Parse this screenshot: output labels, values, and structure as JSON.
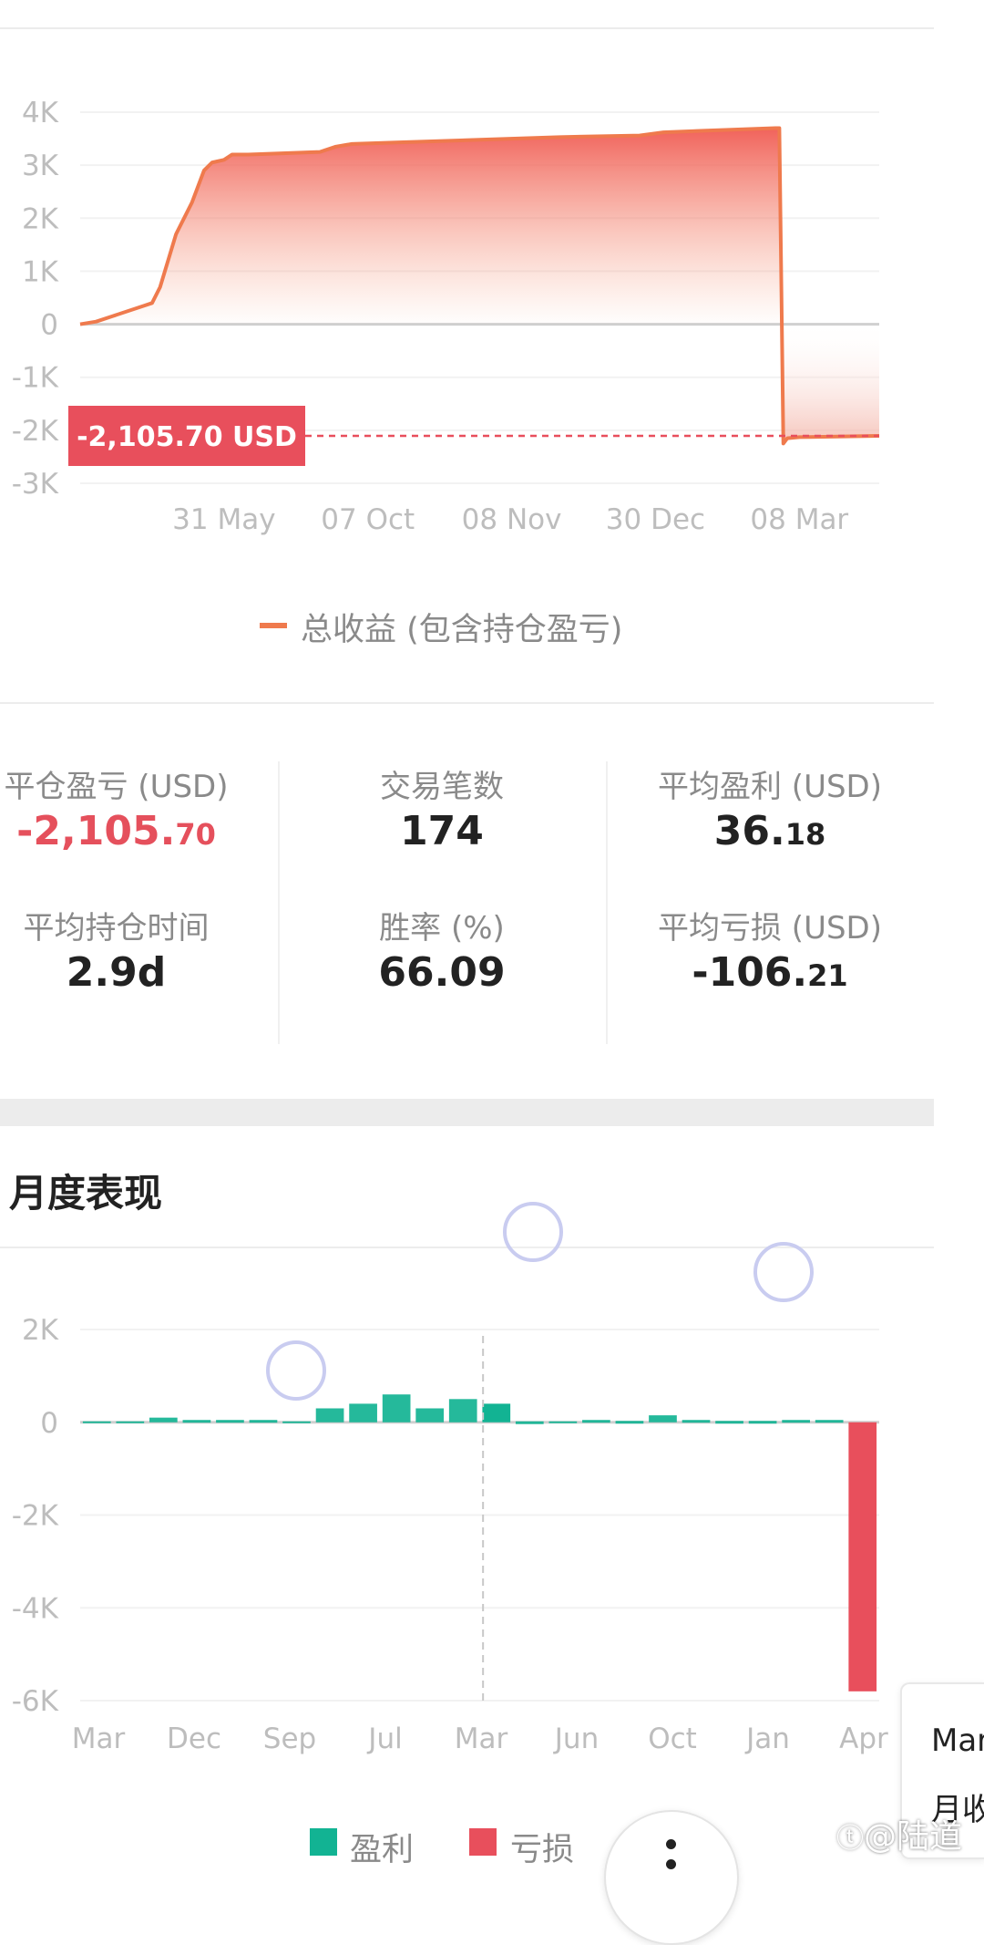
{
  "line_chart_data": {
    "type": "area",
    "series": [
      {
        "name": "总收益 (包含持仓盈亏)"
      }
    ],
    "y_ticks": [
      "4K",
      "3K",
      "2K",
      "1K",
      "0",
      "-1K",
      "-2K",
      "-3K"
    ],
    "y_tick_values": [
      4000,
      3000,
      2000,
      1000,
      0,
      -1000,
      -2000,
      -3000
    ],
    "ylim": [
      -3000,
      4000
    ],
    "x_ticks": [
      "31 May",
      "07 Oct",
      "08 Nov",
      "30 Dec",
      "08 Mar"
    ],
    "x_tick_index": [
      0.18,
      0.36,
      0.54,
      0.72,
      0.9
    ],
    "points_x": [
      0,
      0.02,
      0.04,
      0.08,
      0.09,
      0.1,
      0.12,
      0.14,
      0.155,
      0.165,
      0.18,
      0.19,
      0.21,
      0.3,
      0.32,
      0.34,
      0.4,
      0.5,
      0.6,
      0.7,
      0.73,
      0.78,
      0.87,
      0.875,
      0.88,
      0.885,
      0.9,
      1.0
    ],
    "points_y": [
      0,
      50,
      150,
      350,
      400,
      700,
      1700,
      2300,
      2900,
      3050,
      3100,
      3200,
      3200,
      3250,
      3350,
      3400,
      3430,
      3480,
      3530,
      3560,
      3620,
      3650,
      3700,
      3700,
      -2250,
      -2150,
      -2130,
      -2105.7
    ],
    "current_value_label": "-2,105.70 USD",
    "current_value": -2105.7,
    "line_color": "#ef7a4d",
    "marker_color": "#e84f5c"
  },
  "stats": {
    "closed_pnl": {
      "label": "平仓盈亏 (USD)",
      "int": "-2,105.",
      "dec": "70"
    },
    "trade_count": {
      "label": "交易笔数",
      "int": "174",
      "dec": ""
    },
    "avg_profit": {
      "label": "平均盈利 (USD)",
      "int": "36.",
      "dec": "18"
    },
    "avg_hold": {
      "label": "平均持仓时间",
      "int": "2.9d",
      "dec": ""
    },
    "win_rate": {
      "label": "胜率 (%)",
      "int": "66.09",
      "dec": ""
    },
    "avg_loss": {
      "label": "平均亏损 (USD)",
      "int": "-106.",
      "dec": "21"
    }
  },
  "monthly": {
    "title": "月度表现"
  },
  "chart_data": {
    "type": "bar",
    "y_ticks": [
      "2K",
      "0",
      "-2K",
      "-4K",
      "-6K"
    ],
    "y_tick_values": [
      2000,
      0,
      -2000,
      -4000,
      -6000
    ],
    "ylim": [
      -6000,
      2000
    ],
    "x_ticks": [
      "Mar",
      "Dec",
      "Sep",
      "Jul",
      "Mar",
      "Jun",
      "Oct",
      "Jan",
      "Apr"
    ],
    "values": [
      0,
      0,
      100,
      50,
      50,
      50,
      0,
      300,
      400,
      600,
      300,
      500,
      400,
      20,
      0,
      50,
      30,
      150,
      50,
      30,
      30,
      50,
      50,
      -5800
    ],
    "series": [
      {
        "name": "盈利",
        "color": "#12b393"
      },
      {
        "name": "亏损",
        "color": "#e84f5c"
      }
    ],
    "highlighted_index": 12
  },
  "overlay": {
    "tooltip_line1": "Mar",
    "tooltip_line2": "月收",
    "watermark": "@陆道"
  }
}
